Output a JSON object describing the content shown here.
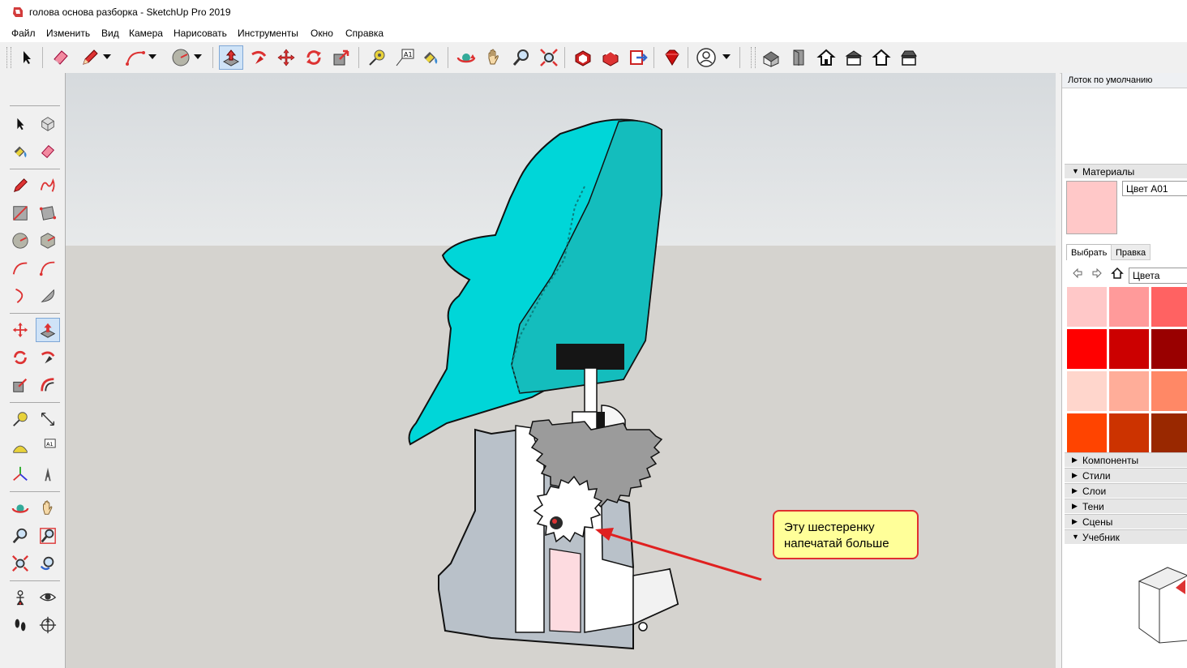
{
  "window": {
    "title": "голова основа разборка - SketchUp Pro 2019"
  },
  "menu": [
    "Файл",
    "Изменить",
    "Вид",
    "Камера",
    "Нарисовать",
    "Инструменты",
    "Окно",
    "Справка"
  ],
  "toolbar": {
    "icons": [
      "select-icon",
      "eraser-icon",
      "pencil-line-icon",
      "line-dropdown-icon",
      "arc-icon",
      "arc-dropdown-icon",
      "circle-icon",
      "circle-dropdown-icon",
      "push-pull-icon",
      "follow-me-icon",
      "move-icon",
      "rotate-icon",
      "scale-icon",
      "tape-measure-icon",
      "text-icon",
      "paint-bucket-icon",
      "orbit-icon",
      "pan-icon",
      "zoom-icon",
      "zoom-extents-icon",
      "3d-warehouse-icon",
      "extension-warehouse-icon",
      "send-to-layout-icon",
      "ruby-console-icon",
      "user-account-icon",
      "iso-view-icon",
      "front-view-icon",
      "top-view-icon",
      "right-view-icon",
      "back-view-icon",
      "left-view-icon"
    ],
    "active": "push-pull-icon"
  },
  "left_tools": [
    "select-icon",
    "component-icon",
    "paint-bucket-icon",
    "eraser-icon",
    "pencil-line-icon",
    "freehand-icon",
    "rectangle-icon",
    "rotated-rectangle-icon",
    "circle-icon",
    "polygon-icon",
    "arc-icon",
    "two-point-arc-icon",
    "three-point-arc-icon",
    "pie-icon",
    "move-icon",
    "push-pull-icon",
    "rotate-icon",
    "follow-me-icon",
    "scale-icon",
    "offset-icon",
    "tape-measure-icon",
    "dimension-icon",
    "protractor-icon",
    "text-icon",
    "axes-icon",
    "3d-text-icon",
    "orbit-icon",
    "pan-icon",
    "zoom-icon",
    "zoom-window-icon",
    "zoom-extents-icon",
    "previous-view-icon",
    "position-camera-icon",
    "look-around-icon",
    "walk-icon",
    "section-plane-icon"
  ],
  "viewport": {
    "callout_line1": "Эту шестеренку",
    "callout_line2": "напечатай больше",
    "colors": {
      "head": "#00cfd0",
      "gear": "#9a9a9a",
      "callout_bg": "#ffff99",
      "callout_border": "#e03030"
    }
  },
  "tray": {
    "title": "Лоток по умолчанию",
    "materials_header": "Материалы",
    "material_name": "Цвет A01",
    "tab_select": "Выбрать",
    "tab_edit": "Правка",
    "collection": "Цвета",
    "swatches": [
      "#ffc8c8",
      "#ff9a9a",
      "#ff6262",
      "#ff0000",
      "#cc0000",
      "#990000",
      "#ffd6cc",
      "#ffad99",
      "#ff8866",
      "#ff4400",
      "#cc3300",
      "#992800"
    ],
    "panels": [
      "Компоненты",
      "Стили",
      "Слои",
      "Тени",
      "Сцены",
      "Учебник"
    ]
  }
}
